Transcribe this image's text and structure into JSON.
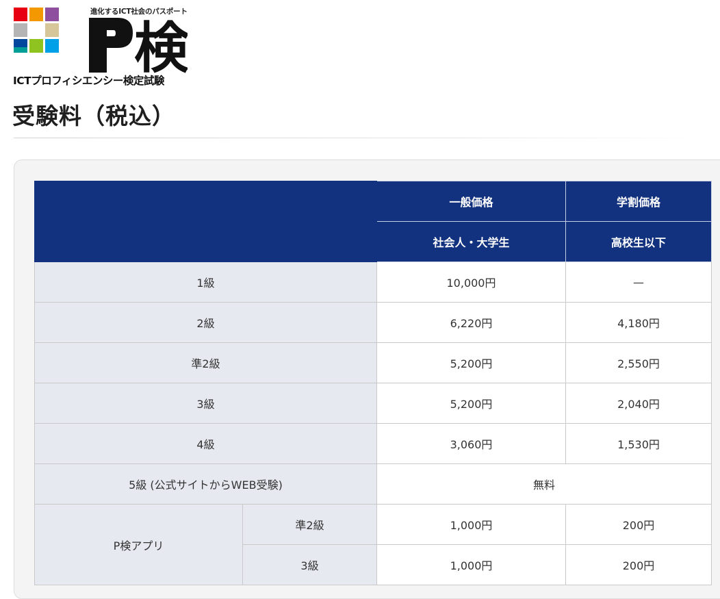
{
  "logo": {
    "tagline": "進化するICT社会のパスポート",
    "mark_letter": "P",
    "mark_kanji": "検",
    "subtitle": "ICTプロフィシエンシー検定試験",
    "grid_colors": [
      "#e60012",
      "#f39800",
      "#8f4f9f",
      "#b5b5b5",
      "#ffffff",
      "#d6c69a",
      "#00479d",
      "#8fc31f",
      "#00a0e9",
      "#009e96"
    ]
  },
  "page": {
    "title": "受験料（税込）"
  },
  "table": {
    "header": {
      "col_general": "一般価格",
      "col_student": "学割価格",
      "col_general_sub": "社会人・大学生",
      "col_student_sub": "高校生以下"
    },
    "rows": [
      {
        "grade": "1級",
        "general": "10,000円",
        "student": "—"
      },
      {
        "grade": "2級",
        "general": "6,220円",
        "student": "4,180円"
      },
      {
        "grade": "準2級",
        "general": "5,200円",
        "student": "2,550円"
      },
      {
        "grade": "3級",
        "general": "5,200円",
        "student": "2,040円"
      },
      {
        "grade": "4級",
        "general": "3,060円",
        "student": "1,530円"
      }
    ],
    "free_row": {
      "grade": "5級 (公式サイトからWEB受験)",
      "price": "無料"
    },
    "app_group": {
      "label": "P検アプリ",
      "rows": [
        {
          "grade": "準2級",
          "general": "1,000円",
          "student": "200円"
        },
        {
          "grade": "3級",
          "general": "1,000円",
          "student": "200円"
        }
      ]
    }
  },
  "colors": {
    "header_navy": "#12317e",
    "row_head_bg": "#e6e9f0"
  }
}
